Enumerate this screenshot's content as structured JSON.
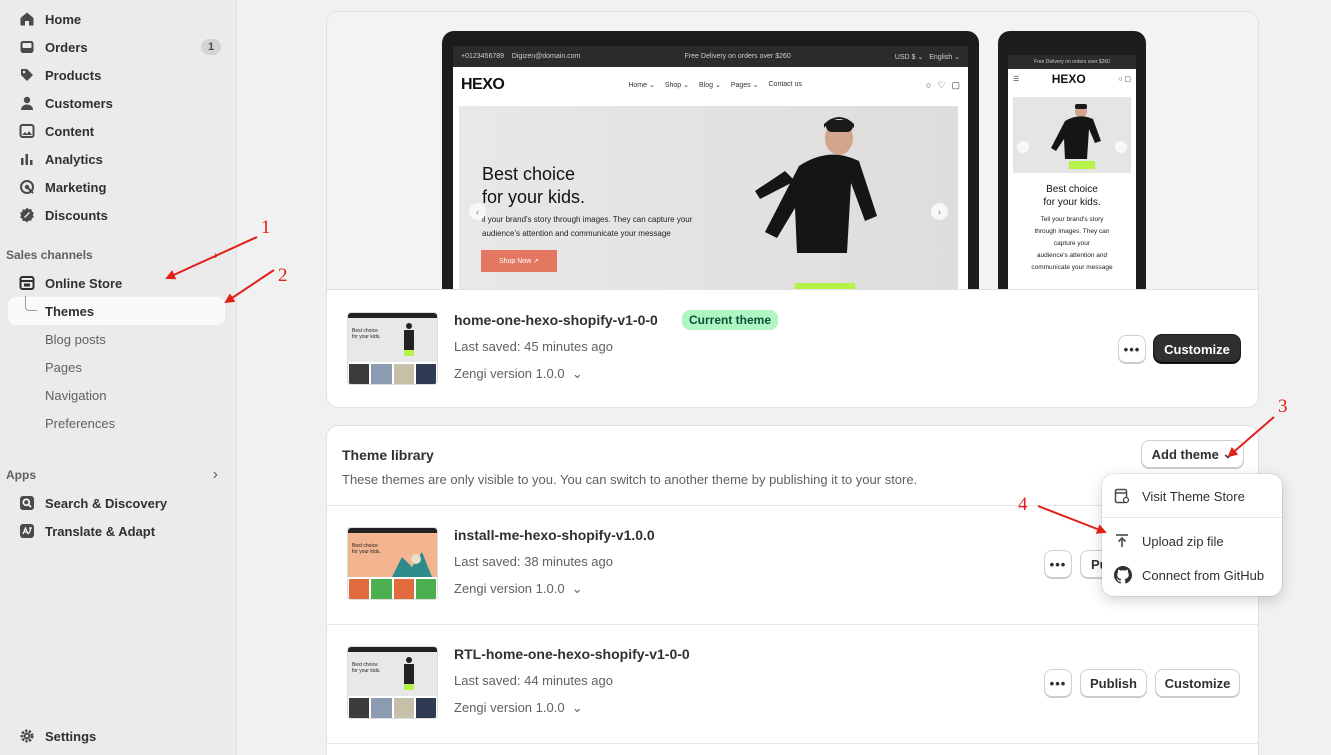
{
  "sidebar": {
    "items": [
      {
        "label": "Home",
        "icon": "home-icon"
      },
      {
        "label": "Orders",
        "icon": "inbox-icon",
        "badge": "1"
      },
      {
        "label": "Products",
        "icon": "tag-icon"
      },
      {
        "label": "Customers",
        "icon": "person-icon"
      },
      {
        "label": "Content",
        "icon": "image-icon"
      },
      {
        "label": "Analytics",
        "icon": "bar-chart-icon"
      },
      {
        "label": "Marketing",
        "icon": "target-icon"
      },
      {
        "label": "Discounts",
        "icon": "discount-icon"
      }
    ],
    "sales_channels_label": "Sales channels",
    "online_store": "Online Store",
    "online_store_sub": [
      "Themes",
      "Blog posts",
      "Pages",
      "Navigation",
      "Preferences"
    ],
    "apps_label": "Apps",
    "apps": [
      {
        "label": "Search & Discovery",
        "icon": "search-app-icon"
      },
      {
        "label": "Translate & Adapt",
        "icon": "translate-app-icon"
      }
    ],
    "settings": "Settings"
  },
  "preview": {
    "desktop": {
      "phone": "+0123456789",
      "email": "Digizen@domain.com",
      "promo": "Free Delivery on orders over $260",
      "currency": "USD $",
      "language": "English",
      "logo": "HEXO",
      "nav": [
        "Home",
        "Shop",
        "Blog",
        "Pages",
        "Contact us"
      ],
      "hero_title_1": "Best choice",
      "hero_title_2": "for your kids.",
      "hero_text": "ll your brand's story through images. They can capture your audience's attention and communicate your message",
      "hero_button": "Shop Now"
    },
    "mobile": {
      "promo": "Free Delivery on orders over $260",
      "logo": "HEXO",
      "title_1": "Best choice",
      "title_2": "for your kids.",
      "text_lines": [
        "Tell your brand's story",
        "through images. They can",
        "capture your",
        "audience's attention and",
        "communicate your message"
      ]
    }
  },
  "current_theme": {
    "name": "home-one-hexo-shopify-v1-0-0",
    "badge": "Current theme",
    "saved": "Last saved: 45 minutes ago",
    "version": "Zengi version 1.0.0",
    "more": "•••",
    "customize": "Customize"
  },
  "library": {
    "title": "Theme library",
    "description": "These themes are only visible to you. You can switch to another theme by publishing it to your store.",
    "add_theme": "Add theme",
    "themes": [
      {
        "name": "install-me-hexo-shopify-v1.0.0",
        "saved": "Last saved: 38 minutes ago",
        "version": "Zengi version 1.0.0",
        "publish": "Pu"
      },
      {
        "name": "RTL-home-one-hexo-shopify-v1-0-0",
        "saved": "Last saved: 44 minutes ago",
        "version": "Zengi version 1.0.0",
        "publish": "Publish",
        "customize": "Customize"
      }
    ],
    "more": "•••"
  },
  "dropdown": {
    "items": [
      {
        "label": "Visit Theme Store",
        "icon": "store-icon"
      },
      {
        "label": "Upload zip file",
        "icon": "upload-icon"
      },
      {
        "label": "Connect from GitHub",
        "icon": "github-icon"
      }
    ]
  },
  "annotations": [
    "1",
    "2",
    "3",
    "4"
  ],
  "colors": {
    "annotation": "#e0201a",
    "current_badge": "#aff6c5",
    "primary_button": "#303030",
    "hero_button": "#e37762"
  }
}
